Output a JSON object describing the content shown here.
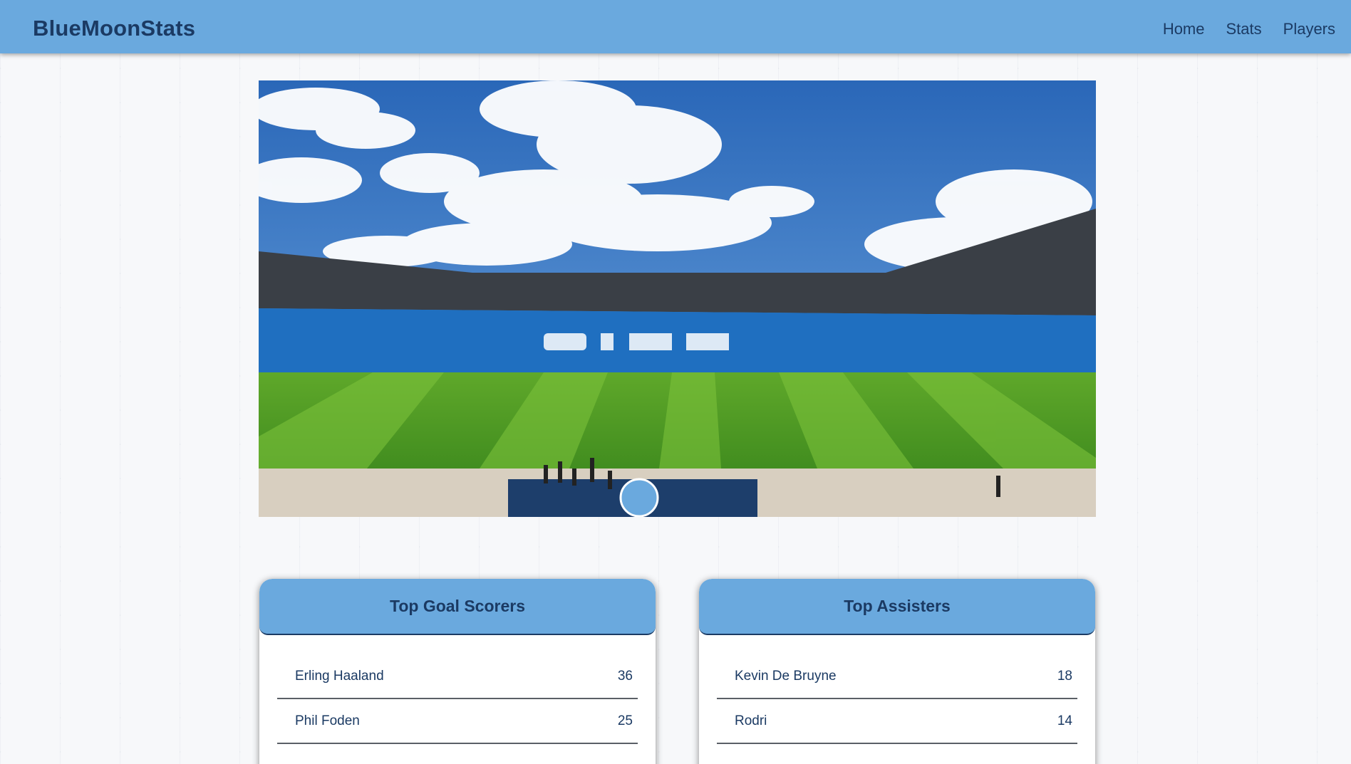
{
  "nav": {
    "brand": "BlueMoonStats",
    "links": [
      {
        "label": "Home"
      },
      {
        "label": "Stats"
      },
      {
        "label": "Players"
      }
    ]
  },
  "hero": {
    "image_subject": "stadium-photo"
  },
  "top_scorers": {
    "title": "Top Goal Scorers",
    "rows": [
      {
        "name": "Erling Haaland",
        "value": "36"
      },
      {
        "name": "Phil Foden",
        "value": "25"
      }
    ]
  },
  "top_assisters": {
    "title": "Top Assisters",
    "rows": [
      {
        "name": "Kevin De Bruyne",
        "value": "18"
      },
      {
        "name": "Rodri",
        "value": "14"
      }
    ]
  },
  "colors": {
    "accent": "#6aa9de",
    "text_dark": "#1b3a63",
    "background": "#f7f8fa"
  }
}
